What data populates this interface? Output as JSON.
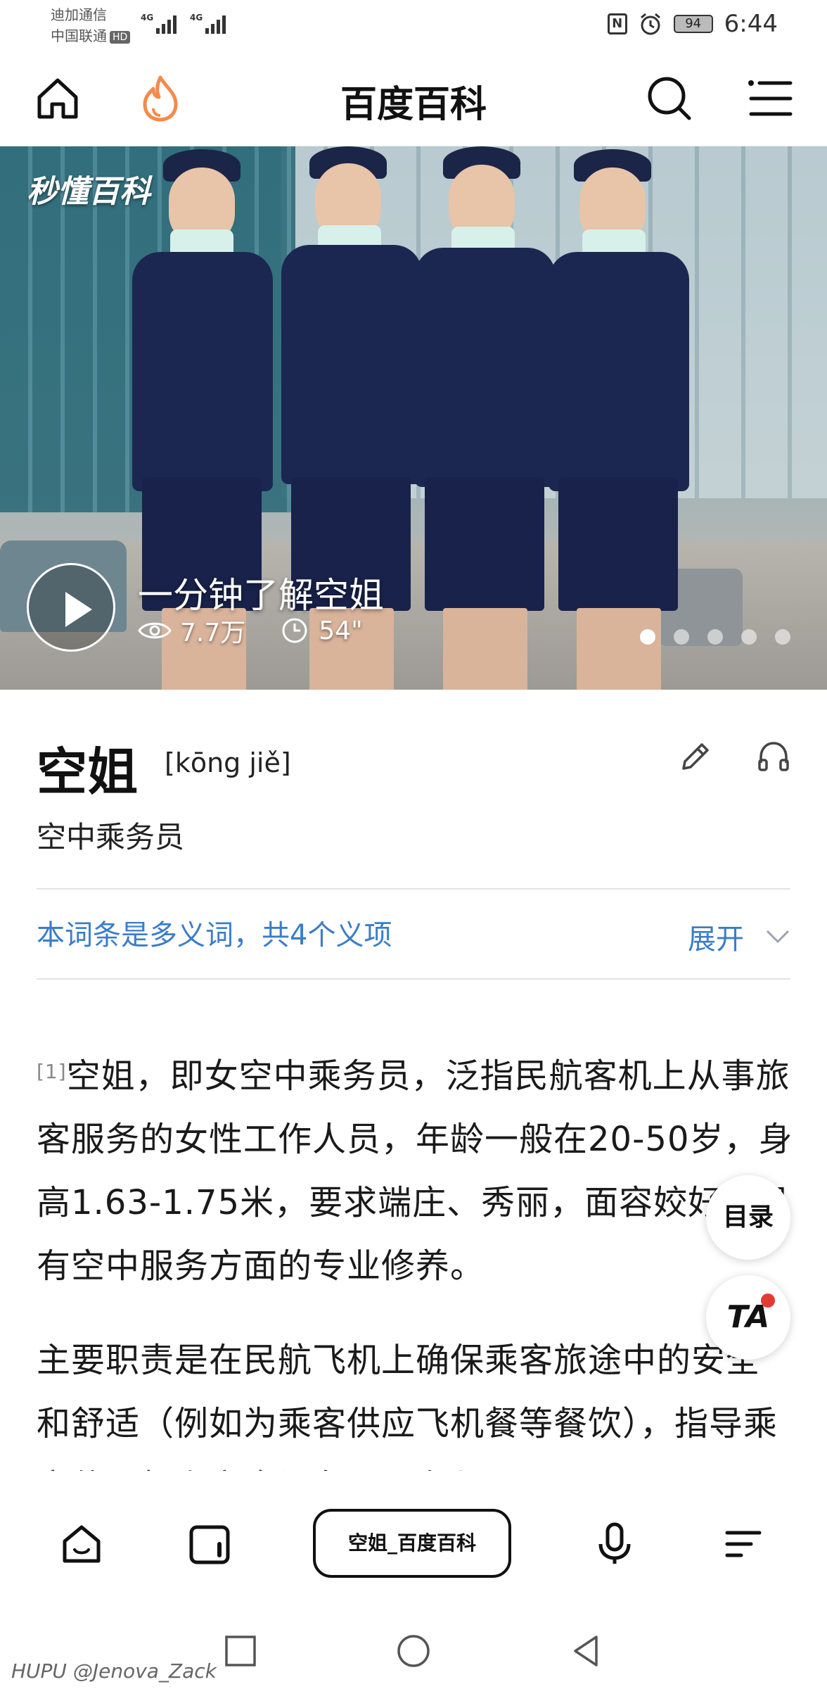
{
  "status_bar": {
    "carrier_1": "迪加通信",
    "carrier_2": "中国联通",
    "hd_badge": "HD",
    "net_1": "4G",
    "net_2": "4G",
    "battery": "94",
    "time": "6:44"
  },
  "header": {
    "title": "百度百科",
    "icons": [
      "home-icon",
      "fire-icon",
      "search-icon",
      "menu-icon"
    ]
  },
  "hero": {
    "logo": "秒懂百科",
    "video_title": "一分钟了解空姐",
    "views": "7.7万",
    "duration": "54\"",
    "carousel_total": 5,
    "carousel_active": 1
  },
  "entry": {
    "title": "空姐",
    "pinyin": "[kōng jiě]",
    "subtitle": "空中乘务员",
    "polysemy": "本词条是多义词，共4个义项",
    "expand_label": "展开"
  },
  "body": {
    "ref_1": "[1]",
    "para_1": "空姐，即女空中乘务员，泛指民航客机上从事旅客服务的女性工作人员，年龄一般在20-50岁，身高1.63-1.75米，要求端庄、秀丽，面容姣好，具有空中服务方面的专业修养。",
    "para_2": "主要职责是在民航飞机上确保乘客旅途中的安全和舒适（例如为乘客供应飞机餐等餐饮），指导乘客使用机上安全设备以及在紧"
  },
  "floating": {
    "toc_label": "目录",
    "ta_label": "TA"
  },
  "toolbar": {
    "search_pill": "空姐_百度百科",
    "icons": [
      "home-icon",
      "tabs-icon",
      "mic-icon",
      "more-icon"
    ]
  },
  "watermark": "HUPU @Jenova_Zack",
  "colors": {
    "link_blue": "#3b7dc9",
    "flame_orange": "#f58a4b",
    "text_dark": "#1a1a1a"
  }
}
